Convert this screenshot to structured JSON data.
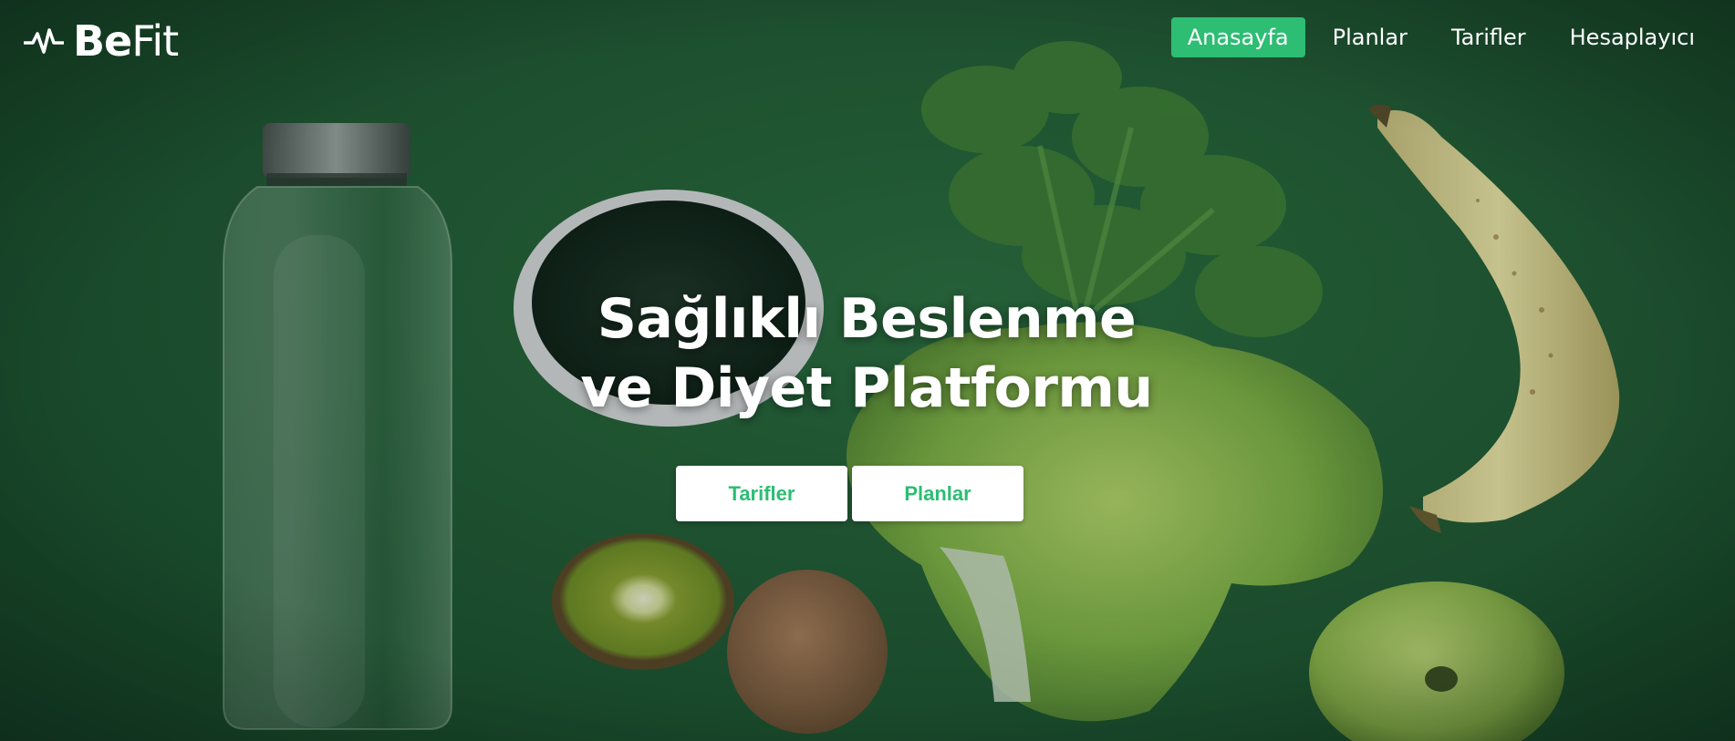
{
  "brand": {
    "logo_bold": "Be",
    "logo_light": "Fit",
    "icon": "pulse-icon"
  },
  "nav": {
    "items": [
      {
        "label": "Anasayfa",
        "active": true
      },
      {
        "label": "Planlar",
        "active": false
      },
      {
        "label": "Tarifler",
        "active": false
      },
      {
        "label": "Hesaplayıcı",
        "active": false
      }
    ]
  },
  "hero": {
    "title_line1": "Sağlıklı Beslenme",
    "title_line2": "ve Diyet Platformu",
    "buttons": [
      {
        "label": "Tarifler"
      },
      {
        "label": "Planlar"
      }
    ]
  },
  "colors": {
    "accent": "#2dbd73",
    "background": "#235a36",
    "button_bg": "#ffffff"
  }
}
